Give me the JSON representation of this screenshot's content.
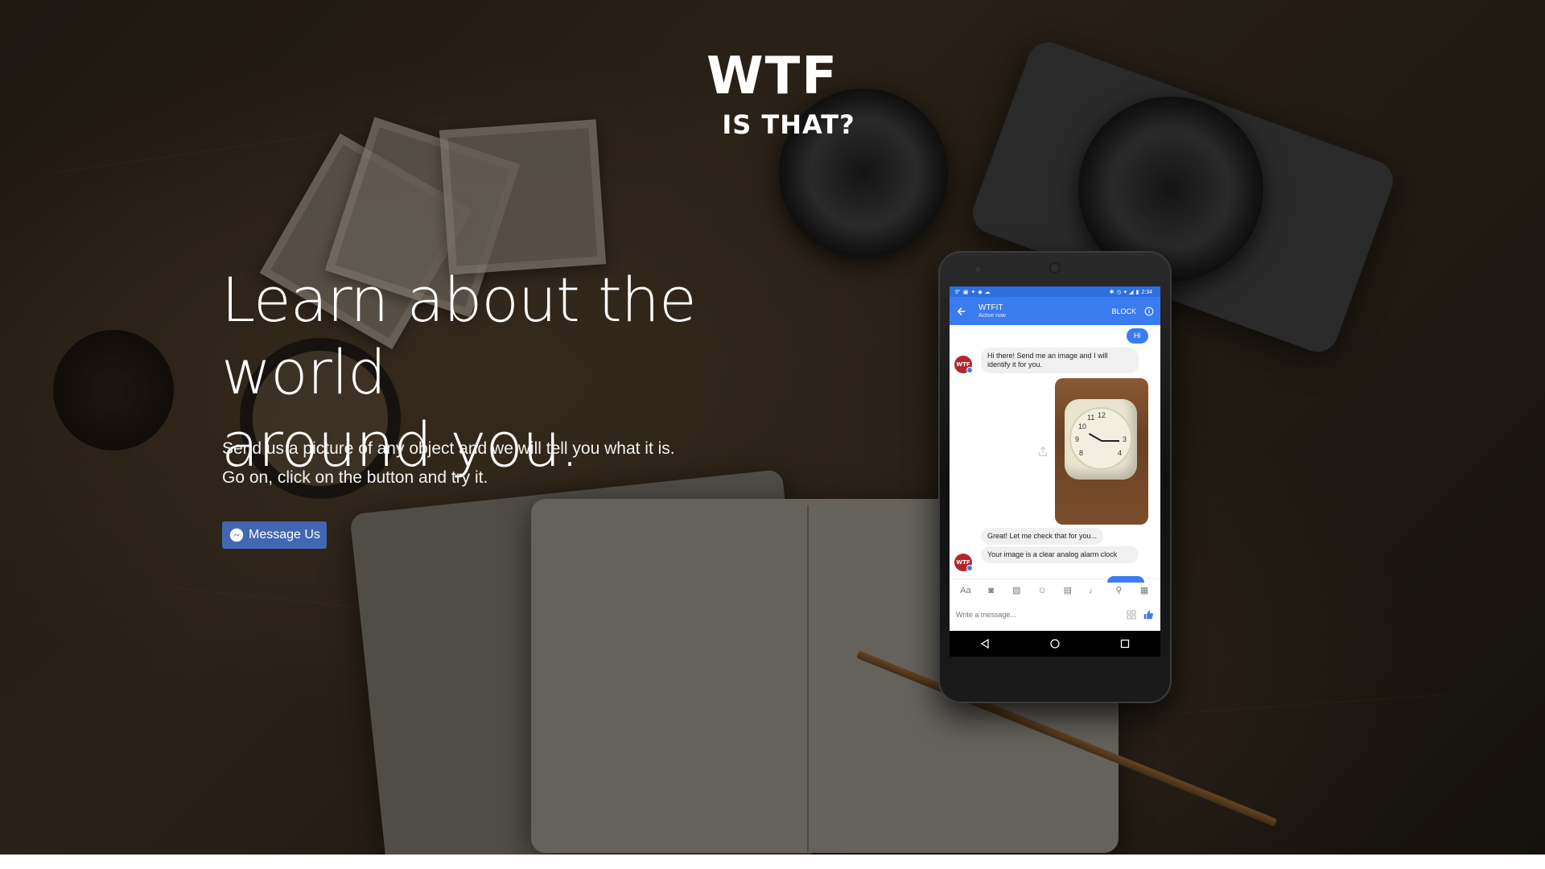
{
  "logo": {
    "main": "WTF",
    "sub": "IS THAT?"
  },
  "hero": {
    "headline_line1": "Learn about the world",
    "headline_line2": "around you.",
    "subline1": "Send us a picture of any object and we will tell you what it is.",
    "subline2": "Go on, click on the button and try it.",
    "cta_label": "Message Us",
    "cta_color": "#4267b2"
  },
  "phone": {
    "status_time": "2:34",
    "chat_title": "WTFIT",
    "chat_status": "Active now",
    "block_label": "BLOCK",
    "avatar_text": "WTF",
    "messages": {
      "hi": "Hi",
      "greeting": "Hi there! Send me an image and I will identify it for you.",
      "checking": "Great! Let me check that for you...",
      "result": "Your image is a clear analog alarm clock"
    },
    "composer_placeholder": "Write a message...",
    "accent": "#3b7bf0"
  }
}
